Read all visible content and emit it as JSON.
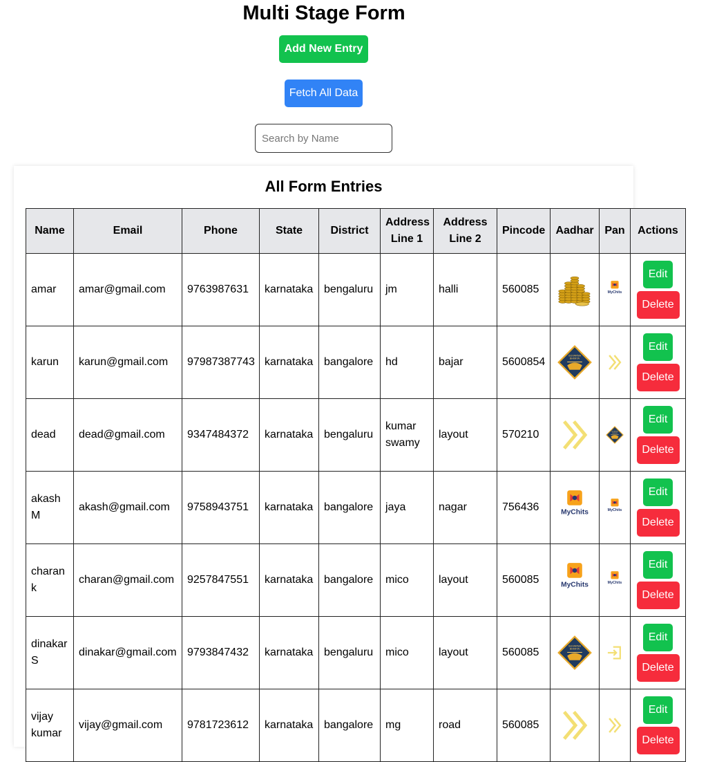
{
  "header": {
    "title": "Multi Stage Form",
    "add_button": "Add New Entry",
    "fetch_button": "Fetch All Data",
    "search_placeholder": "Search by Name"
  },
  "entries_panel": {
    "title": "All Form Entries",
    "columns": [
      "Name",
      "Email",
      "Phone",
      "State",
      "District",
      "Address Line 1",
      "Address Line 2",
      "Pincode",
      "Aadhar",
      "Pan",
      "Actions"
    ],
    "edit_label": "Edit",
    "delete_label": "Delete",
    "rows": [
      {
        "name": "amar",
        "email": "amar@gmail.com",
        "phone": "9763987631",
        "state": "karnataka",
        "district": "bengaluru",
        "address1": "jm",
        "address2": "halli",
        "pincode": "560085",
        "aadhar_icon": "gold-coins-image",
        "pan_icon": "mychits-logo-image"
      },
      {
        "name": "karun",
        "email": "karun@gmail.com",
        "phone": "97987387743",
        "state": "karnataka",
        "district": "bangalore",
        "address1": "hd",
        "address2": "bajar",
        "pincode": "5600854",
        "aadhar_icon": "diamond-badge-image",
        "pan_icon": "double-chevron-image"
      },
      {
        "name": "dead",
        "email": "dead@gmail.com",
        "phone": "9347484372",
        "state": "karnataka",
        "district": "bengaluru",
        "address1": "kumar swamy",
        "address2": "layout",
        "pincode": "570210",
        "aadhar_icon": "double-chevron-image",
        "pan_icon": "diamond-badge-image"
      },
      {
        "name": "akash M",
        "email": "akash@gmail.com",
        "phone": "9758943751",
        "state": "karnataka",
        "district": "bangalore",
        "address1": "jaya",
        "address2": "nagar",
        "pincode": "756436",
        "aadhar_icon": "mychits-logo-image",
        "pan_icon": "mychits-logo-image"
      },
      {
        "name": "charan k",
        "email": "charan@gmail.com",
        "phone": "9257847551",
        "state": "karnataka",
        "district": "bangalore",
        "address1": "mico",
        "address2": "layout",
        "pincode": "560085",
        "aadhar_icon": "mychits-logo-image",
        "pan_icon": "mychits-logo-image"
      },
      {
        "name": "dinakar S",
        "email": "dinakar@gmail.com",
        "phone": "9793847432",
        "state": "karnataka",
        "district": "bengaluru",
        "address1": "mico",
        "address2": "layout",
        "pincode": "560085",
        "aadhar_icon": "diamond-badge-image",
        "pan_icon": "login-arrow-image"
      },
      {
        "name": "vijay kumar",
        "email": "vijay@gmail.com",
        "phone": "9781723612",
        "state": "karnataka",
        "district": "bangalore",
        "address1": "mg",
        "address2": "road",
        "pincode": "560085",
        "aadhar_icon": "double-chevron-image",
        "pan_icon": "double-chevron-image"
      }
    ]
  },
  "logo_text": {
    "mychits": "MyChits",
    "badge_line1": "SUVARNA",
    "badge_line2": "BHIMYA"
  },
  "colors": {
    "add_button": "#12c24e",
    "fetch_button": "#3183f6",
    "edit_button": "#12c24e",
    "delete_button": "#f62c3c",
    "table_header": "#e6e7ea",
    "chevron_yellow": "#f3df74",
    "mychits_orange": "#f7a21b",
    "mychits_navy": "#27386e",
    "badge_navy": "#1f3a5f",
    "coin_gold": "#d4a017"
  }
}
